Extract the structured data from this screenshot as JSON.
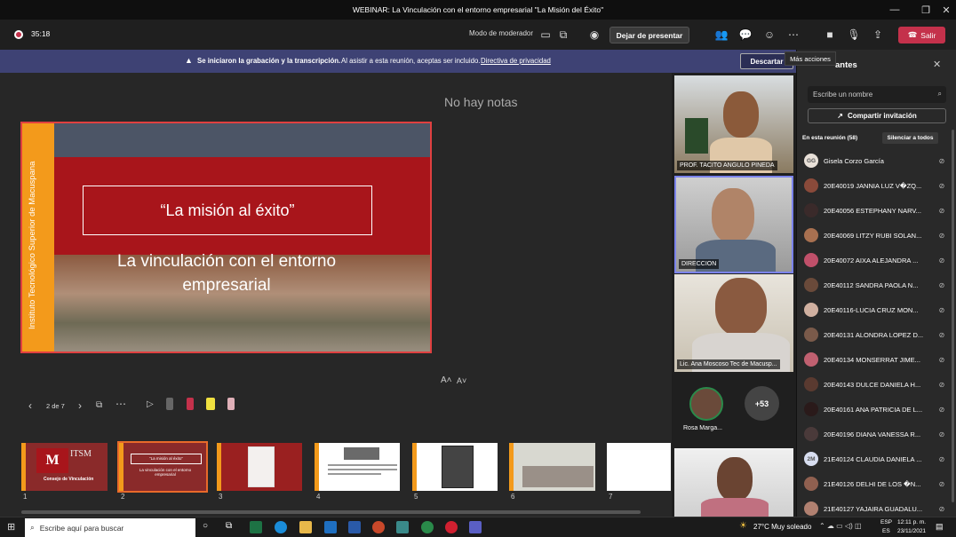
{
  "window": {
    "title": "WEBINAR: La Vinculación con el entorno empresarial \"La Misión del Éxito\""
  },
  "toolbar": {
    "timer": "35:18",
    "moderator_mode": "Modo de moderador",
    "stop_presenting": "Dejar de presentar",
    "leave": "Salir"
  },
  "banner": {
    "bold": "Se iniciaron la grabación y la transcripción.",
    "text": "Al asistir a esta reunión, aceptas ser incluido.",
    "link": "Directiva de privacidad",
    "dismiss": "Descartar"
  },
  "tooltip": "Más acciones",
  "notes": "No hay notas",
  "slide": {
    "side_text": "Instituto Tecnológico Superior de Macuspana",
    "title": "“La misión al éxito”",
    "subtitle": "La vinculación con el entorno empresarial"
  },
  "font_controls": {
    "increase": "A˄",
    "decrease": "A˅"
  },
  "slide_nav": {
    "counter": "2 de 7"
  },
  "thumbnails": [
    {
      "num": "1",
      "caption": "Consejo de Vinculación",
      "logo": "ITSM"
    },
    {
      "num": "2",
      "caption": "“La misión al éxito”",
      "sub": "La vinculación con el entorno empresarial"
    },
    {
      "num": "3"
    },
    {
      "num": "4"
    },
    {
      "num": "5"
    },
    {
      "num": "6"
    },
    {
      "num": "7"
    }
  ],
  "videos": [
    {
      "label": "PROF. TACITO ANGULO PINEDA"
    },
    {
      "label": "DIRECCION"
    },
    {
      "label": "Lic. Ana Moscoso Tec de Macusp..."
    }
  ],
  "small_tiles": {
    "name": "Rosa Marga...",
    "more": "+53"
  },
  "panel": {
    "title": "antes",
    "search_placeholder": "Escribe un nombre",
    "share": "Compartir invitación",
    "section": "En esta reunión (58)",
    "mute_all": "Silenciar a todos",
    "participants": [
      {
        "initials": "GG",
        "name": "Gisela Corzo García",
        "color": "#e8e0d8"
      },
      {
        "initials": "",
        "name": "20E40019 JANNIA LUZ V�ZQ...",
        "color": "#8a4a3a"
      },
      {
        "initials": "",
        "name": "20E40056 ESTEPHANY NARV...",
        "color": "#3a2a2a"
      },
      {
        "initials": "",
        "name": "20E40069 LITZY RUBI SOLAN...",
        "color": "#a87050"
      },
      {
        "initials": "",
        "name": "20E40072 AIXA ALEJANDRA ...",
        "color": "#c0506a"
      },
      {
        "initials": "",
        "name": "20E40112 SANDRA PAOLA N...",
        "color": "#6a4a3a"
      },
      {
        "initials": "",
        "name": "20E40116-LUCIA CRUZ MON...",
        "color": "#d0b0a0"
      },
      {
        "initials": "",
        "name": "20E40131 ALONDRA LOPEZ D...",
        "color": "#7a5a4a"
      },
      {
        "initials": "",
        "name": "20E40134 MONSERRAT JIME...",
        "color": "#c06070"
      },
      {
        "initials": "",
        "name": "20E40143 DULCE DANIELA H...",
        "color": "#5a3a30"
      },
      {
        "initials": "",
        "name": "20E40161 ANA PATRICIA DE L...",
        "color": "#2a1a1a"
      },
      {
        "initials": "",
        "name": "20E40196 DIANA VANESSA R...",
        "color": "#4a3a3a"
      },
      {
        "initials": "2M",
        "name": "21E40124 CLAUDIA DANIELA ...",
        "color": "#d8def0"
      },
      {
        "initials": "",
        "name": "21E40126 DELHI DE LOS �N...",
        "color": "#906050"
      },
      {
        "initials": "",
        "name": "21E40127 YAJAIRA GUADALU...",
        "color": "#b08070"
      }
    ]
  },
  "taskbar": {
    "search": "Escribe aquí para buscar",
    "weather": "27°C  Muy soleado",
    "lang1": "ESP",
    "lang2": "ES",
    "time": "12:11 p. m.",
    "date": "23/11/2021"
  }
}
